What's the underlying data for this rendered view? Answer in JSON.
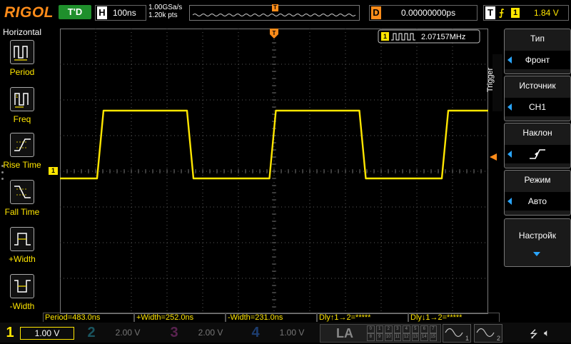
{
  "header": {
    "logo": "RIGOL",
    "run_status": "T'D",
    "horizontal_letter": "H",
    "timebase": "100ns",
    "sample_rate": "1.00GSa/s",
    "memory_depth": "1.20k pts",
    "mem_trigger_marker": "T",
    "delay_letter": "D",
    "delay_value": "0.00000000ps",
    "trigger_letter": "T",
    "trigger_edge_symbol": "⨍",
    "trigger_source": "1",
    "trigger_level": "1.84 V"
  },
  "left_menu": {
    "title": "Horizontal",
    "items": [
      {
        "label": "Period",
        "icon": "period-icon"
      },
      {
        "label": "Freq",
        "icon": "frequency-icon"
      },
      {
        "label": "Rise Time",
        "icon": "rise-time-icon"
      },
      {
        "label": "Fall Time",
        "icon": "fall-time-icon"
      },
      {
        "label": "+Width",
        "icon": "positive-width-icon"
      },
      {
        "label": "-Width",
        "icon": "negative-width-icon"
      }
    ]
  },
  "screen": {
    "trigger_position_marker": "T",
    "channel1_marker": "1",
    "frequency_counter": {
      "channel": "1",
      "value": "2.07157MHz"
    }
  },
  "right_menu": {
    "tab_label": "Trigger",
    "buttons": [
      {
        "title": "Тип",
        "value": "Фронт"
      },
      {
        "title": "Источник",
        "value": "CH1"
      },
      {
        "title": "Наклон",
        "value": ""
      },
      {
        "title": "Режим",
        "value": "Авто"
      },
      {
        "title": "Настройк",
        "value": ""
      }
    ]
  },
  "measurements": [
    "Period=483.0ns",
    "+Width=252.0ns",
    "-Width=231.0ns",
    "Dly↑1→2=*****",
    "Dly↓1→2=*****"
  ],
  "channels": [
    {
      "num": "1",
      "scale": "1.00 V",
      "color": "#ffe600"
    },
    {
      "num": "2",
      "scale": "2.00 V",
      "color": "#17a2b8"
    },
    {
      "num": "3",
      "scale": "2.00 V",
      "color": "#e040c0"
    },
    {
      "num": "4",
      "scale": "1.00 V",
      "color": "#2a7fff"
    }
  ],
  "la": {
    "label": "LA",
    "bits_row1": [
      "0",
      "1",
      "2",
      "3",
      "4",
      "5",
      "6",
      "7"
    ],
    "bits_row2": [
      "8",
      "9",
      "10",
      "11",
      "12",
      "13",
      "14",
      "15"
    ]
  },
  "generators": [
    {
      "num": "1"
    },
    {
      "num": "2"
    }
  ],
  "colors": {
    "ch1": "#ffe600",
    "trigger": "#ff8c1a",
    "run_status": "#1f8f2c",
    "highlight": "#2aa6ff"
  },
  "waveform": {
    "channel": "1",
    "period_ns": 483.0,
    "high_width_ns": 252.0,
    "low_width_ns": 231.0,
    "timebase_ns_per_div": 100,
    "volts_per_div": 1.0,
    "high_level_div": 1.7,
    "low_level_div": -0.2,
    "trigger_level_div": 0.4
  }
}
